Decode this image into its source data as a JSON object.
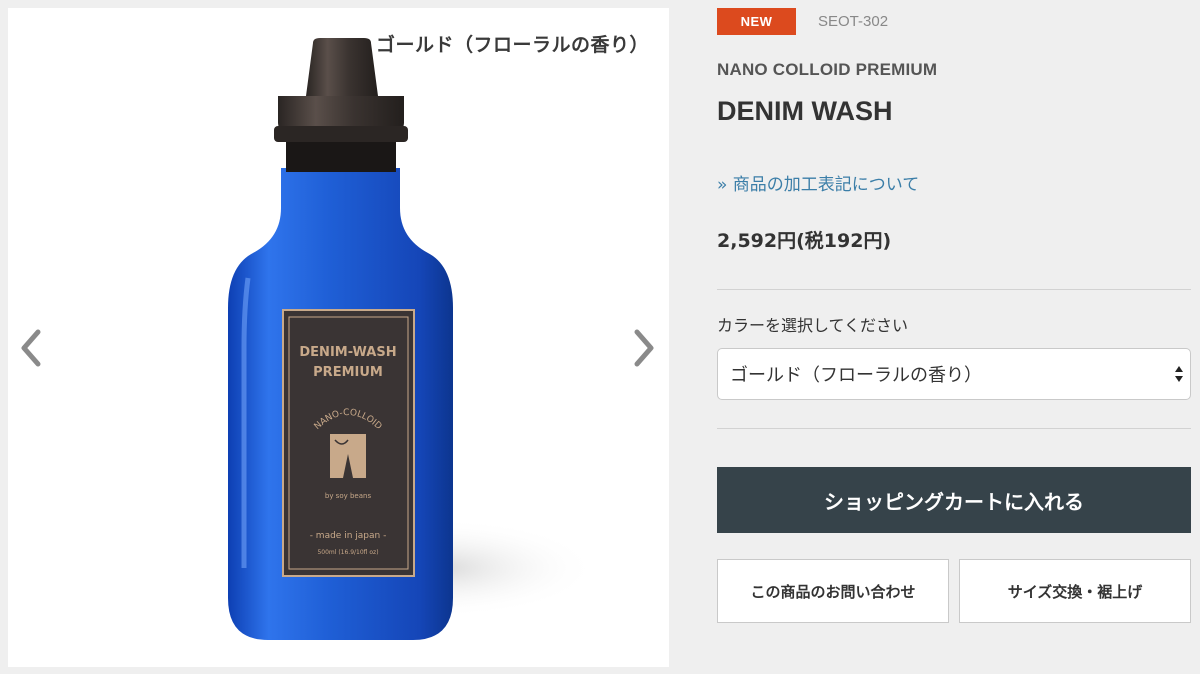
{
  "gallery": {
    "caption": "ゴールド（フローラルの香り）",
    "prev_icon": "chevron-left-icon",
    "next_icon": "chevron-right-icon",
    "label": {
      "line1": "DENIM-WASH",
      "line2": "PREMIUM",
      "arc": "NANO-COLLOID",
      "by": "by soy beans",
      "made": "- made in japan -",
      "volume": "500ml (16.9/10fl oz)"
    }
  },
  "product": {
    "badge": "NEW",
    "sku": "SEOT-302",
    "brand": "NANO COLLOID PREMIUM",
    "name": "DENIM WASH",
    "processing_link": "» 商品の加工表記について",
    "price": "2,592円(税192円)"
  },
  "color_select": {
    "label": "カラーを選択してください",
    "selected": "ゴールド（フローラルの香り）"
  },
  "buttons": {
    "cart": "ショッピングカートに入れる",
    "inquiry": "この商品のお問い合わせ",
    "size_exchange": "サイズ交換・裾上げ"
  },
  "colors": {
    "badge": "#dc4a1e",
    "cart_button": "#36434a",
    "link": "#3b7ea8",
    "bottle": "#1f5fd6"
  }
}
